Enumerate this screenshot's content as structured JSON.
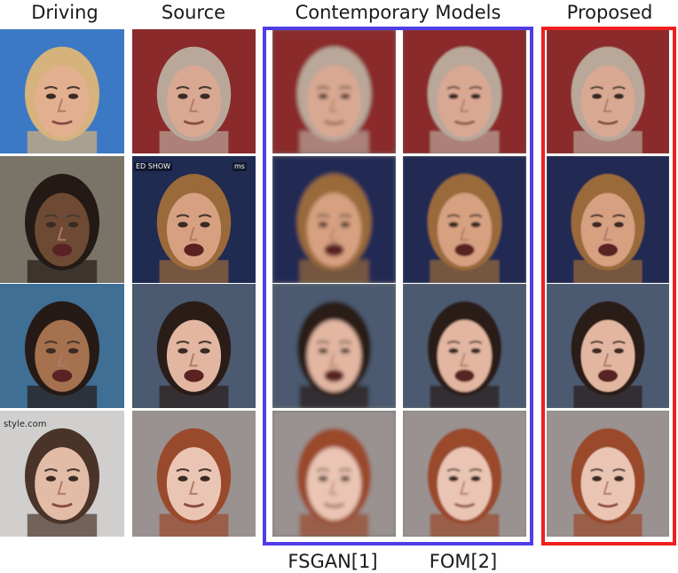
{
  "headers": {
    "driving": "Driving",
    "source": "Source",
    "contemporary": "Contemporary Models",
    "proposed": "Proposed"
  },
  "footers": {
    "fsgan": "FSGAN[1]",
    "fom": "FOM[2]"
  },
  "overlay_text": {
    "news_show": "ED SHOW",
    "channel": "ms",
    "style": "style.com"
  },
  "colors": {
    "contemporary_frame": "#4f3ee8",
    "proposed_frame": "#ee1f1f"
  },
  "rows": [
    {
      "bg": "#8a2a2a",
      "skin": "#d9a892",
      "hair": "#b9a79a",
      "mouth_open": false
    },
    {
      "bg": "#202b52",
      "skin": "#d7a081",
      "hair": "#9a6a3a",
      "mouth_open": true
    },
    {
      "bg": "#4b5a70",
      "skin": "#e2b6a1",
      "hair": "#2a1d18",
      "mouth_open": true
    },
    {
      "bg": "#9a9290",
      "skin": "#ebc5b4",
      "hair": "#9a4a2c",
      "mouth_open": false
    }
  ],
  "driving_faces": [
    {
      "bg": "#3c79c4",
      "skin": "#e3b08f",
      "hair": "#d6b27d"
    },
    {
      "bg": "#7a7468",
      "skin": "#6e4a35",
      "hair": "#241a15"
    },
    {
      "bg": "#3f6f95",
      "skin": "#a5714f",
      "hair": "#251a15"
    },
    {
      "bg": "#d0cfce",
      "skin": "#e3bca7",
      "hair": "#4a3328"
    }
  ]
}
